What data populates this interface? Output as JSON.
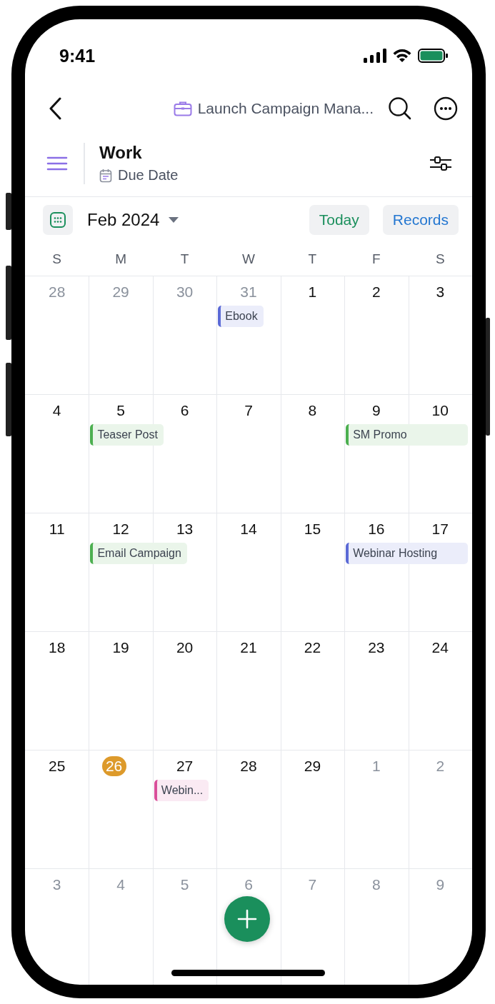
{
  "status_bar": {
    "time": "9:41"
  },
  "nav": {
    "title": "Launch Campaign Mana..."
  },
  "view": {
    "name": "Work",
    "field": "Due Date"
  },
  "toolbar": {
    "month": "Feb 2024",
    "today_button": "Today",
    "records_button": "Records"
  },
  "weekdays": [
    "S",
    "M",
    "T",
    "W",
    "T",
    "F",
    "S"
  ],
  "weeks": [
    {
      "days": [
        {
          "label": "28",
          "in_month": false,
          "today": false
        },
        {
          "label": "29",
          "in_month": false,
          "today": false
        },
        {
          "label": "30",
          "in_month": false,
          "today": false
        },
        {
          "label": "31",
          "in_month": false,
          "today": false,
          "events": [
            {
              "title": "Ebook",
              "color": "#5b6ad6",
              "multi_day": false
            }
          ]
        },
        {
          "label": "1",
          "in_month": true,
          "today": false
        },
        {
          "label": "2",
          "in_month": true,
          "today": false
        },
        {
          "label": "3",
          "in_month": true,
          "today": false
        }
      ]
    },
    {
      "days": [
        {
          "label": "4",
          "in_month": true,
          "today": false
        },
        {
          "label": "5",
          "in_month": true,
          "today": false,
          "events": [
            {
              "title": "Teaser Post",
              "color": "#4caf50",
              "multi_day": false
            }
          ]
        },
        {
          "label": "6",
          "in_month": true,
          "today": false
        },
        {
          "label": "7",
          "in_month": true,
          "today": false
        },
        {
          "label": "8",
          "in_month": true,
          "today": false
        },
        {
          "label": "9",
          "in_month": true,
          "today": false,
          "events": [
            {
              "title": "SM Promo",
              "color": "#4caf50",
              "multi_day": true
            }
          ]
        },
        {
          "label": "10",
          "in_month": true,
          "today": false
        }
      ]
    },
    {
      "days": [
        {
          "label": "11",
          "in_month": true,
          "today": false
        },
        {
          "label": "12",
          "in_month": true,
          "today": false,
          "events": [
            {
              "title": "Email Campaign",
              "color": "#4caf50",
              "multi_day": false
            }
          ]
        },
        {
          "label": "13",
          "in_month": true,
          "today": false
        },
        {
          "label": "14",
          "in_month": true,
          "today": false
        },
        {
          "label": "15",
          "in_month": true,
          "today": false
        },
        {
          "label": "16",
          "in_month": true,
          "today": false,
          "events": [
            {
              "title": "Webinar Hosting",
              "color": "#5b6ad6",
              "multi_day": true
            }
          ]
        },
        {
          "label": "17",
          "in_month": true,
          "today": false
        }
      ]
    },
    {
      "days": [
        {
          "label": "18",
          "in_month": true,
          "today": false
        },
        {
          "label": "19",
          "in_month": true,
          "today": false
        },
        {
          "label": "20",
          "in_month": true,
          "today": false
        },
        {
          "label": "21",
          "in_month": true,
          "today": false
        },
        {
          "label": "22",
          "in_month": true,
          "today": false
        },
        {
          "label": "23",
          "in_month": true,
          "today": false
        },
        {
          "label": "24",
          "in_month": true,
          "today": false
        }
      ]
    },
    {
      "days": [
        {
          "label": "25",
          "in_month": true,
          "today": false
        },
        {
          "label": "26",
          "in_month": true,
          "today": true
        },
        {
          "label": "27",
          "in_month": true,
          "today": false,
          "events": [
            {
              "title": "Webin...",
              "color": "#d94f9a",
              "multi_day": false
            }
          ]
        },
        {
          "label": "28",
          "in_month": true,
          "today": false
        },
        {
          "label": "29",
          "in_month": true,
          "today": false
        },
        {
          "label": "1",
          "in_month": false,
          "today": false
        },
        {
          "label": "2",
          "in_month": false,
          "today": false
        }
      ]
    },
    {
      "days": [
        {
          "label": "3",
          "in_month": false,
          "today": false
        },
        {
          "label": "4",
          "in_month": false,
          "today": false
        },
        {
          "label": "5",
          "in_month": false,
          "today": false
        },
        {
          "label": "6",
          "in_month": false,
          "today": false
        },
        {
          "label": "7",
          "in_month": false,
          "today": false
        },
        {
          "label": "8",
          "in_month": false,
          "today": false
        },
        {
          "label": "9",
          "in_month": false,
          "today": false
        }
      ]
    }
  ]
}
